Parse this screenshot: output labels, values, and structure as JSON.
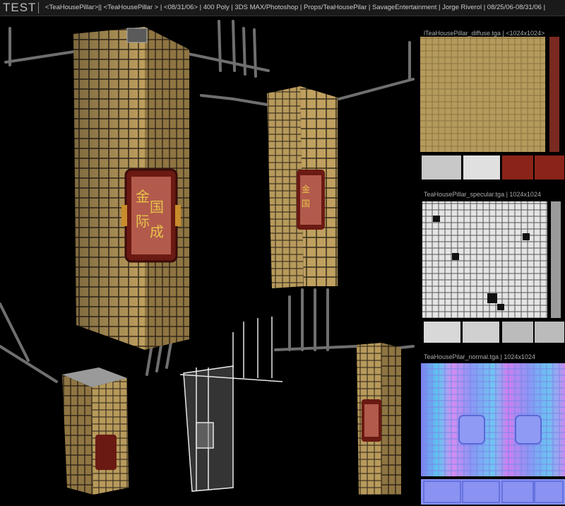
{
  "header": {
    "title": "TEST",
    "info": "<TeaHousePillar>|| <TeaHousePillar > | <08/31/06> | 400 Poly | 3DS MAX/Photoshop | Props/TeaHousePilar | SavageEntertainment  | Jorge Riverol  | 08/25/06-08/31/06 |"
  },
  "textures": {
    "diffuse_label": "lTeaHousePillar_diffuse.tga |  <1024x1024>",
    "specular_label": "TeaHousePillar_specular.tga | 1024x1024",
    "normal_label": "TeaHousePilar_normal.tga | 1024x1024"
  },
  "colors": {
    "tile": "#b89a5a",
    "grout": "#4a3b22",
    "background": "#000000",
    "sign_frame": "#7a1e14"
  }
}
